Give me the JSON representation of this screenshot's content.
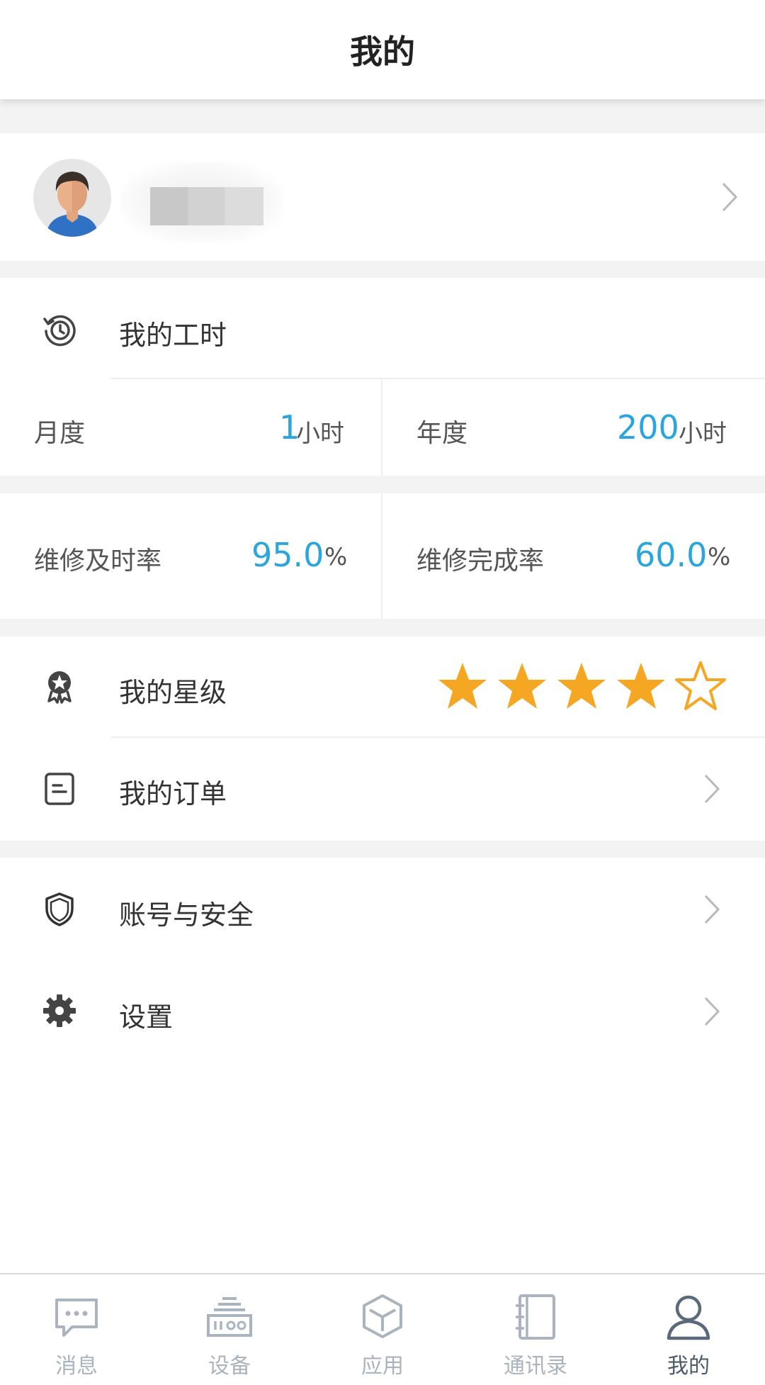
{
  "header": {
    "title": "我的"
  },
  "worktime": {
    "title": "我的工时",
    "monthly_label": "月度",
    "monthly_value": "1",
    "monthly_unit": "小时",
    "yearly_label": "年度",
    "yearly_value": "200",
    "yearly_unit": "小时"
  },
  "rates": {
    "timely_label": "维修及时率",
    "timely_value": "95.0",
    "timely_unit": "%",
    "complete_label": "维修完成率",
    "complete_value": "60.0",
    "complete_unit": "%"
  },
  "rating": {
    "title": "我的星级",
    "stars": 4,
    "max_stars": 5,
    "star_color": "#f5a623"
  },
  "menu": {
    "orders_label": "我的订单",
    "security_label": "账号与安全",
    "settings_label": "设置"
  },
  "tabbar": {
    "items": [
      {
        "label": "消息",
        "icon": "chat-icon"
      },
      {
        "label": "设备",
        "icon": "device-icon"
      },
      {
        "label": "应用",
        "icon": "cube-icon"
      },
      {
        "label": "通讯录",
        "icon": "contacts-icon"
      },
      {
        "label": "我的",
        "icon": "person-icon"
      }
    ],
    "active_index": 4
  },
  "colors": {
    "accent": "#2aa6dc",
    "star": "#f5a623",
    "tab_active": "#4a5a6a",
    "tab_inactive": "#aab4bf"
  }
}
